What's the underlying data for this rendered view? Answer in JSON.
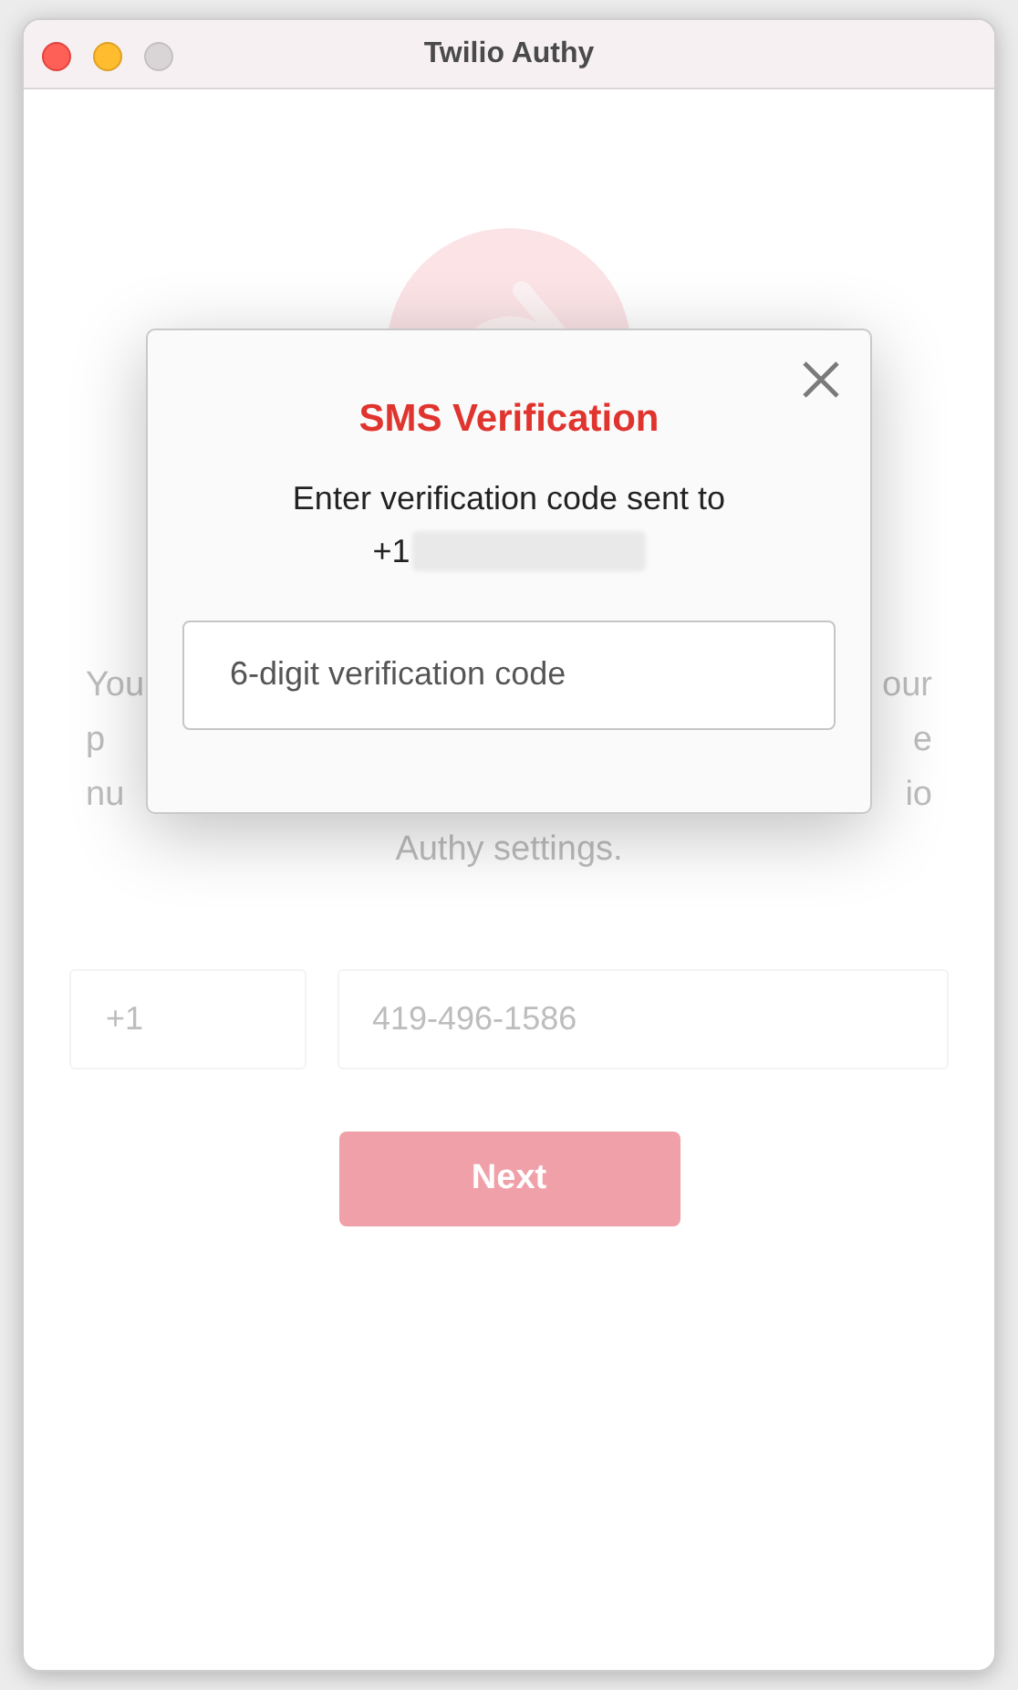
{
  "window": {
    "title": "Twilio Authy"
  },
  "background": {
    "text_fragments": [
      {
        "left": "You",
        "right": "our"
      },
      {
        "left": "p",
        "right": "e"
      },
      {
        "left": "nu",
        "right": "io"
      }
    ],
    "text_last_line": "Authy settings.",
    "country_code": "+1",
    "phone_placeholder": "419-496-1586",
    "next_button": "Next"
  },
  "dialog": {
    "title": "SMS Verification",
    "message": "Enter verification code sent to",
    "phone_prefix": "+1",
    "code_placeholder": "6-digit verification code"
  }
}
